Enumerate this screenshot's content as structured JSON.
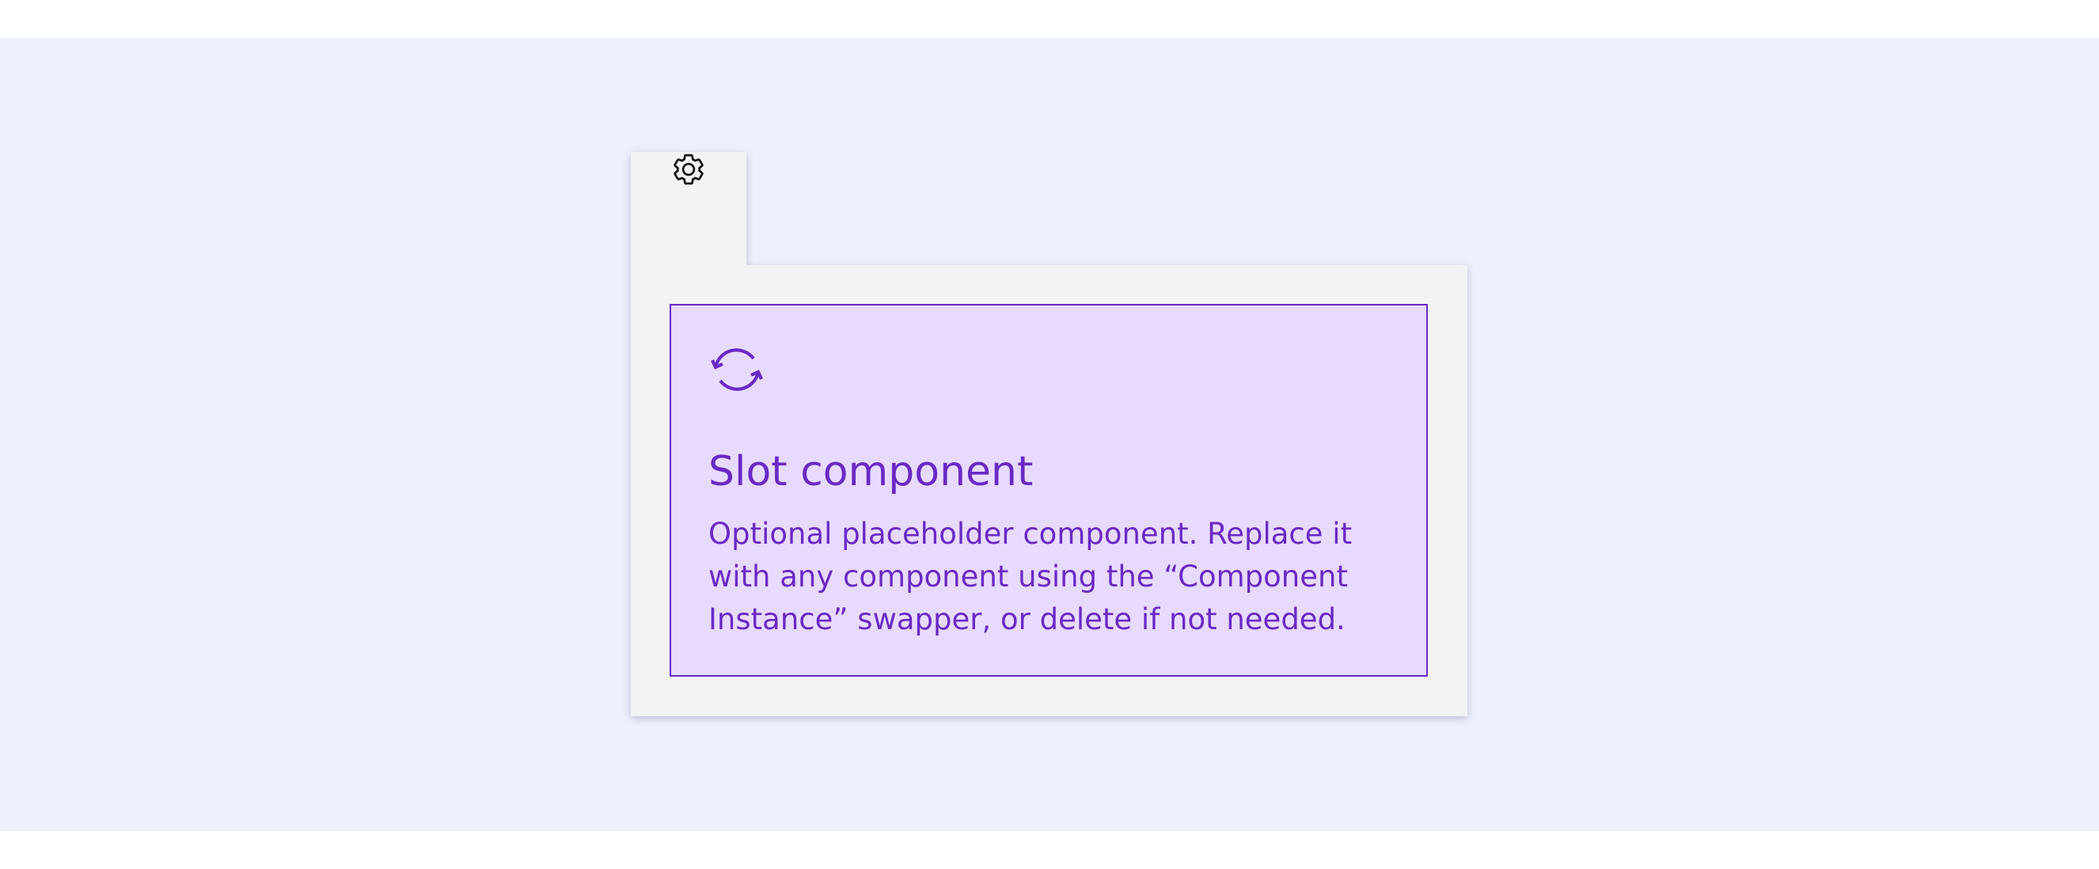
{
  "toolbar": {
    "settings_icon": "gear-icon"
  },
  "slot": {
    "icon": "swap-icon",
    "title": "Slot component",
    "description": "Optional placeholder component. Replace it with any component using the “Component Instance” swapper, or delete if not needed."
  },
  "colors": {
    "canvas_background": "#edf0fe",
    "panel_background": "#f3f3f3",
    "slot_background": "#e8daff",
    "slot_accent": "#6929c4",
    "icon": "#161616"
  }
}
